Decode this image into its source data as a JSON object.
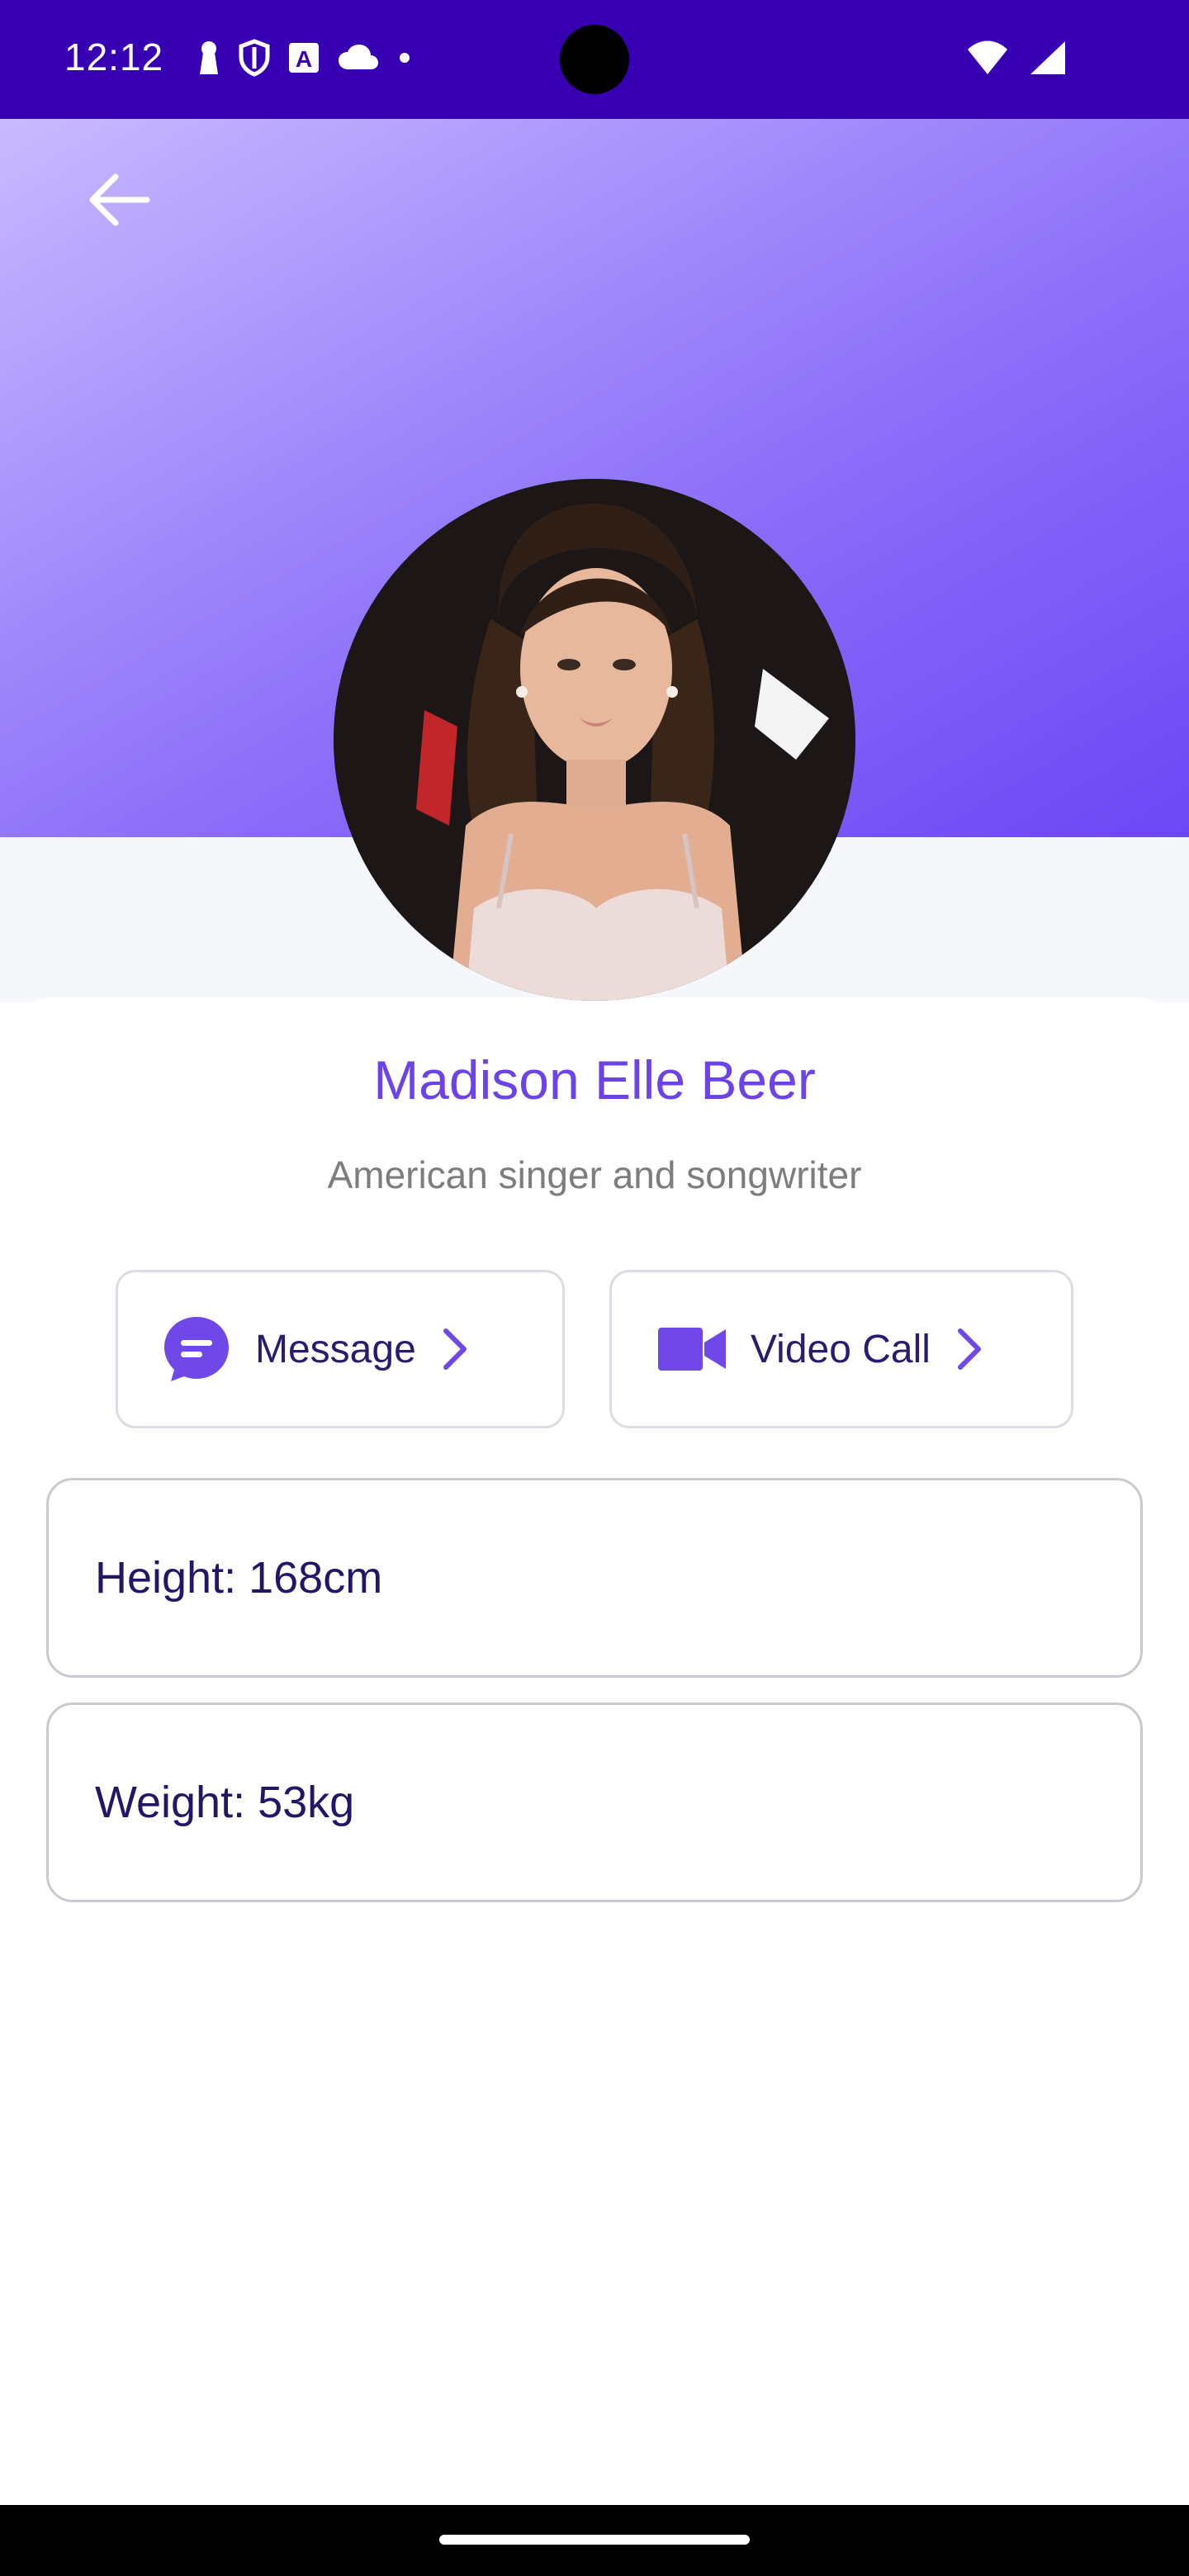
{
  "status_bar": {
    "time": "12:12",
    "left_icons": [
      "keyhole-icon",
      "shield-icon",
      "a-badge-icon",
      "cloud-icon",
      "dot-icon"
    ],
    "right_icons": [
      "wifi-icon",
      "signal-icon"
    ]
  },
  "header": {
    "back_icon": "arrow-left-icon",
    "gradient_start": "#c9b9ff",
    "gradient_end": "#6c47f5"
  },
  "profile": {
    "name": "Madison Elle Beer",
    "subtitle": "American singer and songwriter"
  },
  "actions": {
    "message": {
      "label": "Message",
      "icon": "message-bubble-icon"
    },
    "video_call": {
      "label": "Video Call",
      "icon": "video-camera-icon"
    }
  },
  "details": {
    "height": "Height: 168cm",
    "weight": "Weight: 53kg"
  },
  "colors": {
    "status_bar": "#3700b3",
    "accent": "#6c43e8",
    "text_dark": "#241566"
  }
}
